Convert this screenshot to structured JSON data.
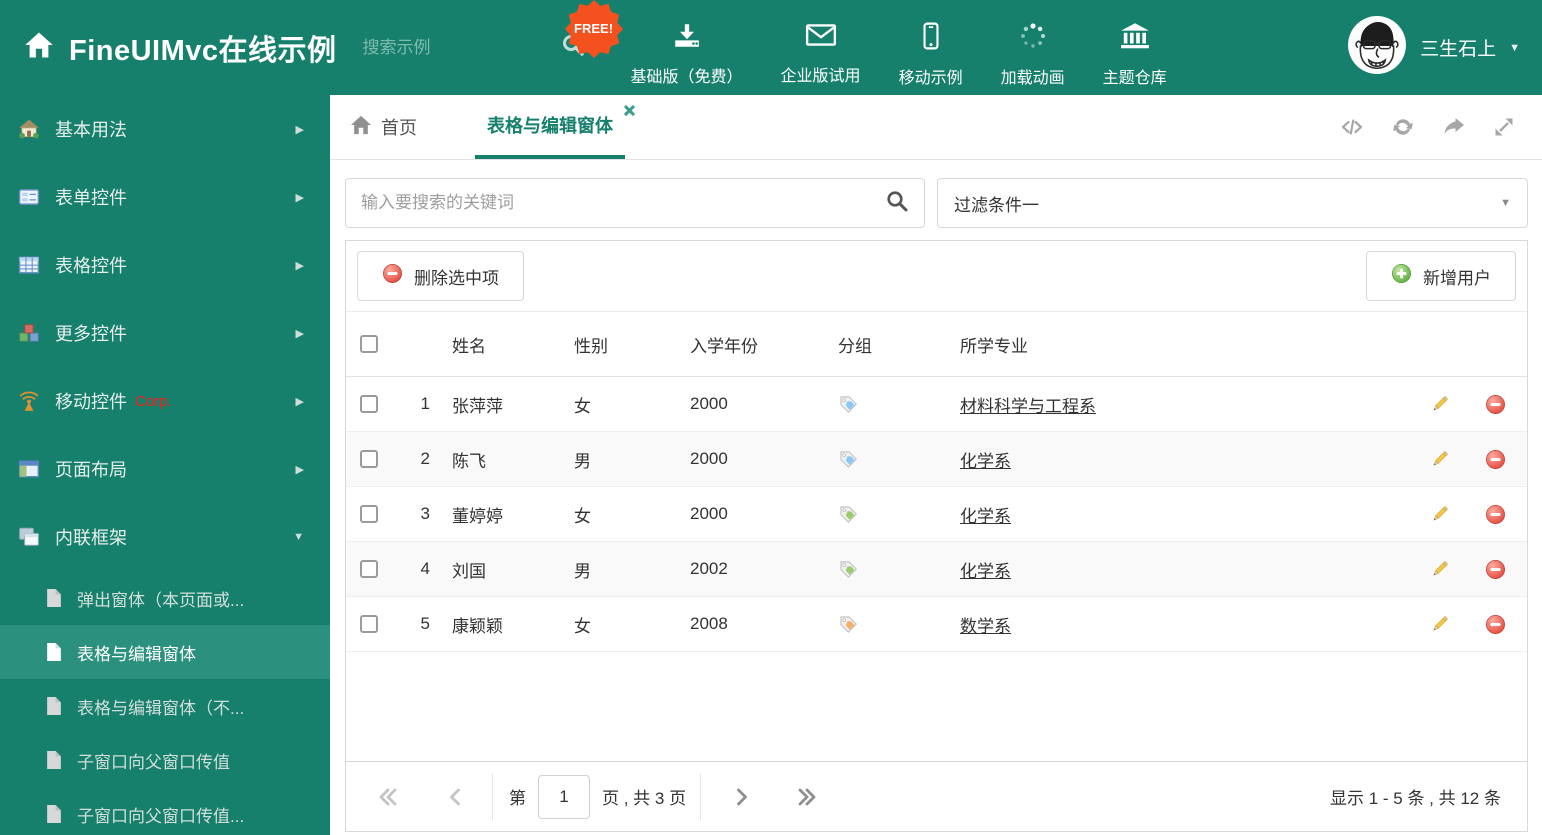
{
  "theme": {
    "teal": "#16806C",
    "teal_selected": "#2B917E",
    "badge_orange": "#F4511E",
    "tag_blue": "#8CC8F5",
    "tag_green": "#9CCB6B",
    "tag_orange": "#F5B06C"
  },
  "header": {
    "logo_title": "FineUIMvc在线示例",
    "search_placeholder": "搜索示例",
    "free_badge": "FREE!",
    "nav": [
      {
        "icon": "download-icon",
        "label": "基础版（免费）"
      },
      {
        "icon": "envelope-icon",
        "label": "企业版试用"
      },
      {
        "icon": "mobile-icon",
        "label": "移动示例"
      },
      {
        "icon": "spinner-icon",
        "label": "加载动画"
      },
      {
        "icon": "bank-icon",
        "label": "主题仓库"
      }
    ],
    "username": "三生石上"
  },
  "sidebar": {
    "groups": [
      {
        "icon": "home-colorful-icon",
        "label": "基本用法",
        "state": "collapsed"
      },
      {
        "icon": "form-icon",
        "label": "表单控件",
        "state": "collapsed"
      },
      {
        "icon": "table-icon",
        "label": "表格控件",
        "state": "collapsed"
      },
      {
        "icon": "cubes-icon",
        "label": "更多控件",
        "state": "collapsed"
      },
      {
        "icon": "antenna-icon",
        "label": "移动控件",
        "badge": "Corp.",
        "state": "collapsed"
      },
      {
        "icon": "layout-icon",
        "label": "页面布局",
        "state": "collapsed"
      },
      {
        "icon": "frames-icon",
        "label": "内联框架",
        "state": "expanded"
      }
    ],
    "subitems": [
      {
        "label": "弹出窗体（本页面或...",
        "active": false
      },
      {
        "label": "表格与编辑窗体",
        "active": true
      },
      {
        "label": "表格与编辑窗体（不...",
        "active": false
      },
      {
        "label": "子窗口向父窗口传值",
        "active": false
      },
      {
        "label": "子窗口向父窗口传值...",
        "active": false
      }
    ]
  },
  "tabs": {
    "home": "首页",
    "active": "表格与编辑窗体"
  },
  "filters": {
    "search_placeholder": "输入要搜索的关键词",
    "filter_value": "过滤条件一"
  },
  "toolbar": {
    "delete_label": "删除选中项",
    "add_label": "新增用户"
  },
  "table": {
    "headers": {
      "name": "姓名",
      "gender": "性别",
      "year": "入学年份",
      "group": "分组",
      "major": "所学专业"
    },
    "rows": [
      {
        "num": "1",
        "name": "张萍萍",
        "gender": "女",
        "year": "2000",
        "tag_color": "#8CC8F5",
        "major": "材料科学与工程系"
      },
      {
        "num": "2",
        "name": "陈飞",
        "gender": "男",
        "year": "2000",
        "tag_color": "#8CC8F5",
        "major": "化学系"
      },
      {
        "num": "3",
        "name": "董婷婷",
        "gender": "女",
        "year": "2000",
        "tag_color": "#9CCB6B",
        "major": "化学系"
      },
      {
        "num": "4",
        "name": "刘国",
        "gender": "男",
        "year": "2002",
        "tag_color": "#9CCB6B",
        "major": "化学系"
      },
      {
        "num": "5",
        "name": "康颖颖",
        "gender": "女",
        "year": "2008",
        "tag_color": "#F5B06C",
        "major": "数学系"
      }
    ]
  },
  "pagination": {
    "prefix": "第",
    "page": "1",
    "suffix": "页 , 共 3 页",
    "summary": "显示 1 - 5 条 , 共 12 条"
  }
}
